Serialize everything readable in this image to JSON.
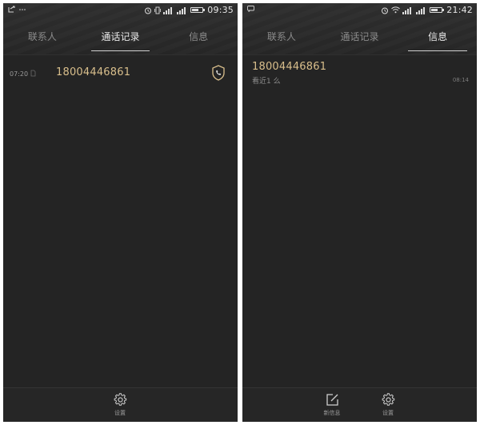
{
  "screens": [
    {
      "statusbar": {
        "left_label": "",
        "time": "09:35",
        "battery_level": 0.7
      },
      "tabs": [
        {
          "label": "联系人",
          "active": false
        },
        {
          "label": "通话记录",
          "active": true
        },
        {
          "label": "信息",
          "active": false
        }
      ],
      "call_log": [
        {
          "time": "07:20",
          "number": "18004446861",
          "icon": "shield-phone-icon"
        }
      ],
      "bottom": [
        {
          "label": "设置",
          "icon": "gear-icon"
        }
      ]
    },
    {
      "statusbar": {
        "time": "21:42",
        "battery_level": 0.7
      },
      "tabs": [
        {
          "label": "联系人",
          "active": false
        },
        {
          "label": "通话记录",
          "active": false
        },
        {
          "label": "信息",
          "active": true
        }
      ],
      "messages": [
        {
          "number": "18004446861",
          "preview": "看近1 么",
          "date": "08:14"
        }
      ],
      "bottom": [
        {
          "label": "新信息",
          "icon": "compose-icon"
        },
        {
          "label": "设置",
          "icon": "gear-icon"
        }
      ]
    }
  ],
  "colors": {
    "background": "#242424",
    "accent_number": "#d9bf8c",
    "active_tab": "#e8e8e8",
    "inactive_tab": "#8a8a8a"
  }
}
